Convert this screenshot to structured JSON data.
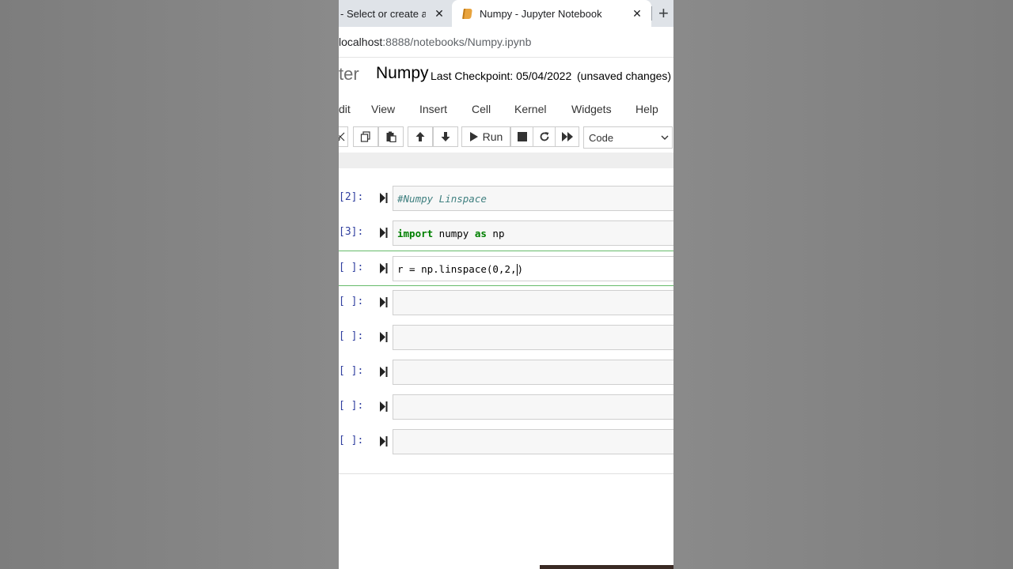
{
  "browser": {
    "tabs": [
      {
        "label": "- Select or create a n",
        "active": false
      },
      {
        "label": "Numpy - Jupyter Notebook",
        "active": true
      }
    ],
    "close_glyph": "✕",
    "new_tab_glyph": "+",
    "url_host": "localhost",
    "url_path": ":8888/notebooks/Numpy.ipynb"
  },
  "jupyter": {
    "logo_fragment": "ter",
    "notebook_name": "Numpy",
    "checkpoint": "Last Checkpoint: 05/04/2022",
    "save_status": "(unsaved changes)",
    "menu": [
      "dit",
      "View",
      "Insert",
      "Cell",
      "Kernel",
      "Widgets",
      "Help"
    ],
    "toolbar": {
      "run_label": "Run",
      "cell_type": "Code",
      "icons": [
        "cut-icon",
        "copy-icon",
        "paste-icon",
        "move-up-icon",
        "move-down-icon",
        "run-icon",
        "interrupt-icon",
        "restart-icon",
        "restart-run-all-icon"
      ]
    },
    "cells": [
      {
        "prompt": "[2]:",
        "code": "#Numpy Linspace"
      },
      {
        "prompt": "[3]:",
        "code_kw1": "import",
        "code_mid": " numpy ",
        "code_kw2": "as",
        "code_tail": " np"
      },
      {
        "prompt": "[ ]:",
        "code": "r = np.linspace(0,2,",
        "close": ")"
      },
      {
        "prompt": "[ ]:",
        "code": ""
      },
      {
        "prompt": "[ ]:",
        "code": ""
      },
      {
        "prompt": "[ ]:",
        "code": ""
      },
      {
        "prompt": "[ ]:",
        "code": ""
      },
      {
        "prompt": "[ ]:",
        "code": ""
      }
    ]
  },
  "colors": {
    "prompt": "#303f9f",
    "keyword": "#008000",
    "comment": "#408080",
    "selected_border": "#66bb6a"
  }
}
